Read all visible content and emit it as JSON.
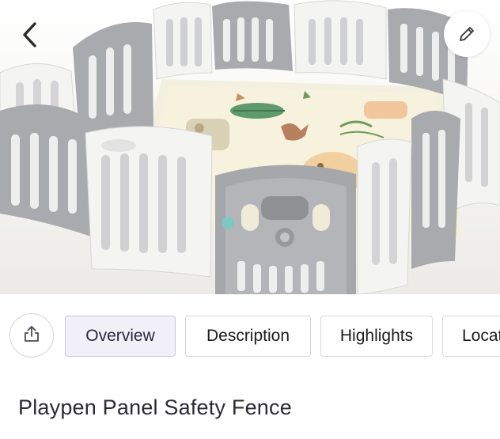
{
  "header": {
    "back_icon": "chevron-left-icon",
    "edit_icon": "pencil-icon"
  },
  "product_image": {
    "subject": "playpen"
  },
  "share": {
    "icon": "share-icon"
  },
  "tabs": [
    {
      "label": "Overview",
      "active": true
    },
    {
      "label": "Description",
      "active": false
    },
    {
      "label": "Highlights",
      "active": false
    },
    {
      "label": "Locat",
      "active": false
    }
  ],
  "product": {
    "title": "Playpen Panel Safety Fence"
  },
  "colors": {
    "active_tab_bg": "#f1f0f8",
    "tab_border": "#d8d8dc",
    "title_text": "#2b2b36",
    "panel_gray": "#a9aaad",
    "panel_white": "#f4f4f2"
  }
}
